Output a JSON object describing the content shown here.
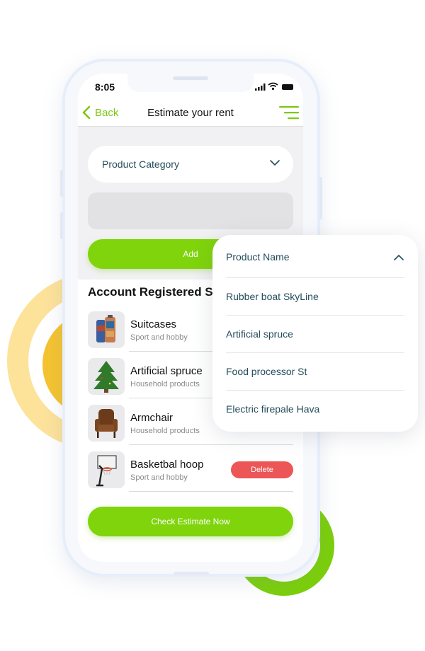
{
  "status": {
    "time": "8:05"
  },
  "nav": {
    "back_label": "Back",
    "title": "Estimate your rent"
  },
  "form": {
    "category_label": "Product Category",
    "add_label": "Add"
  },
  "list": {
    "title": "Account Registered S",
    "items": [
      {
        "name": "Suitcases",
        "category": "Sport and hobby"
      },
      {
        "name": "Artificial spruce",
        "category": "Household products"
      },
      {
        "name": "Armchair",
        "category": "Household products"
      },
      {
        "name": "Basketbal hoop",
        "category": "Sport and hobby",
        "action": "Delete"
      }
    ]
  },
  "check_label": "Check Estimate Now",
  "dropdown": {
    "header": "Product Name",
    "options": [
      "Rubber boat SkyLine",
      "Artificial spruce",
      "Food processor St",
      "Electric firepale Hava"
    ]
  },
  "colors": {
    "accent": "#7fd40b",
    "danger": "#ec5656",
    "label": "#244c5a"
  }
}
